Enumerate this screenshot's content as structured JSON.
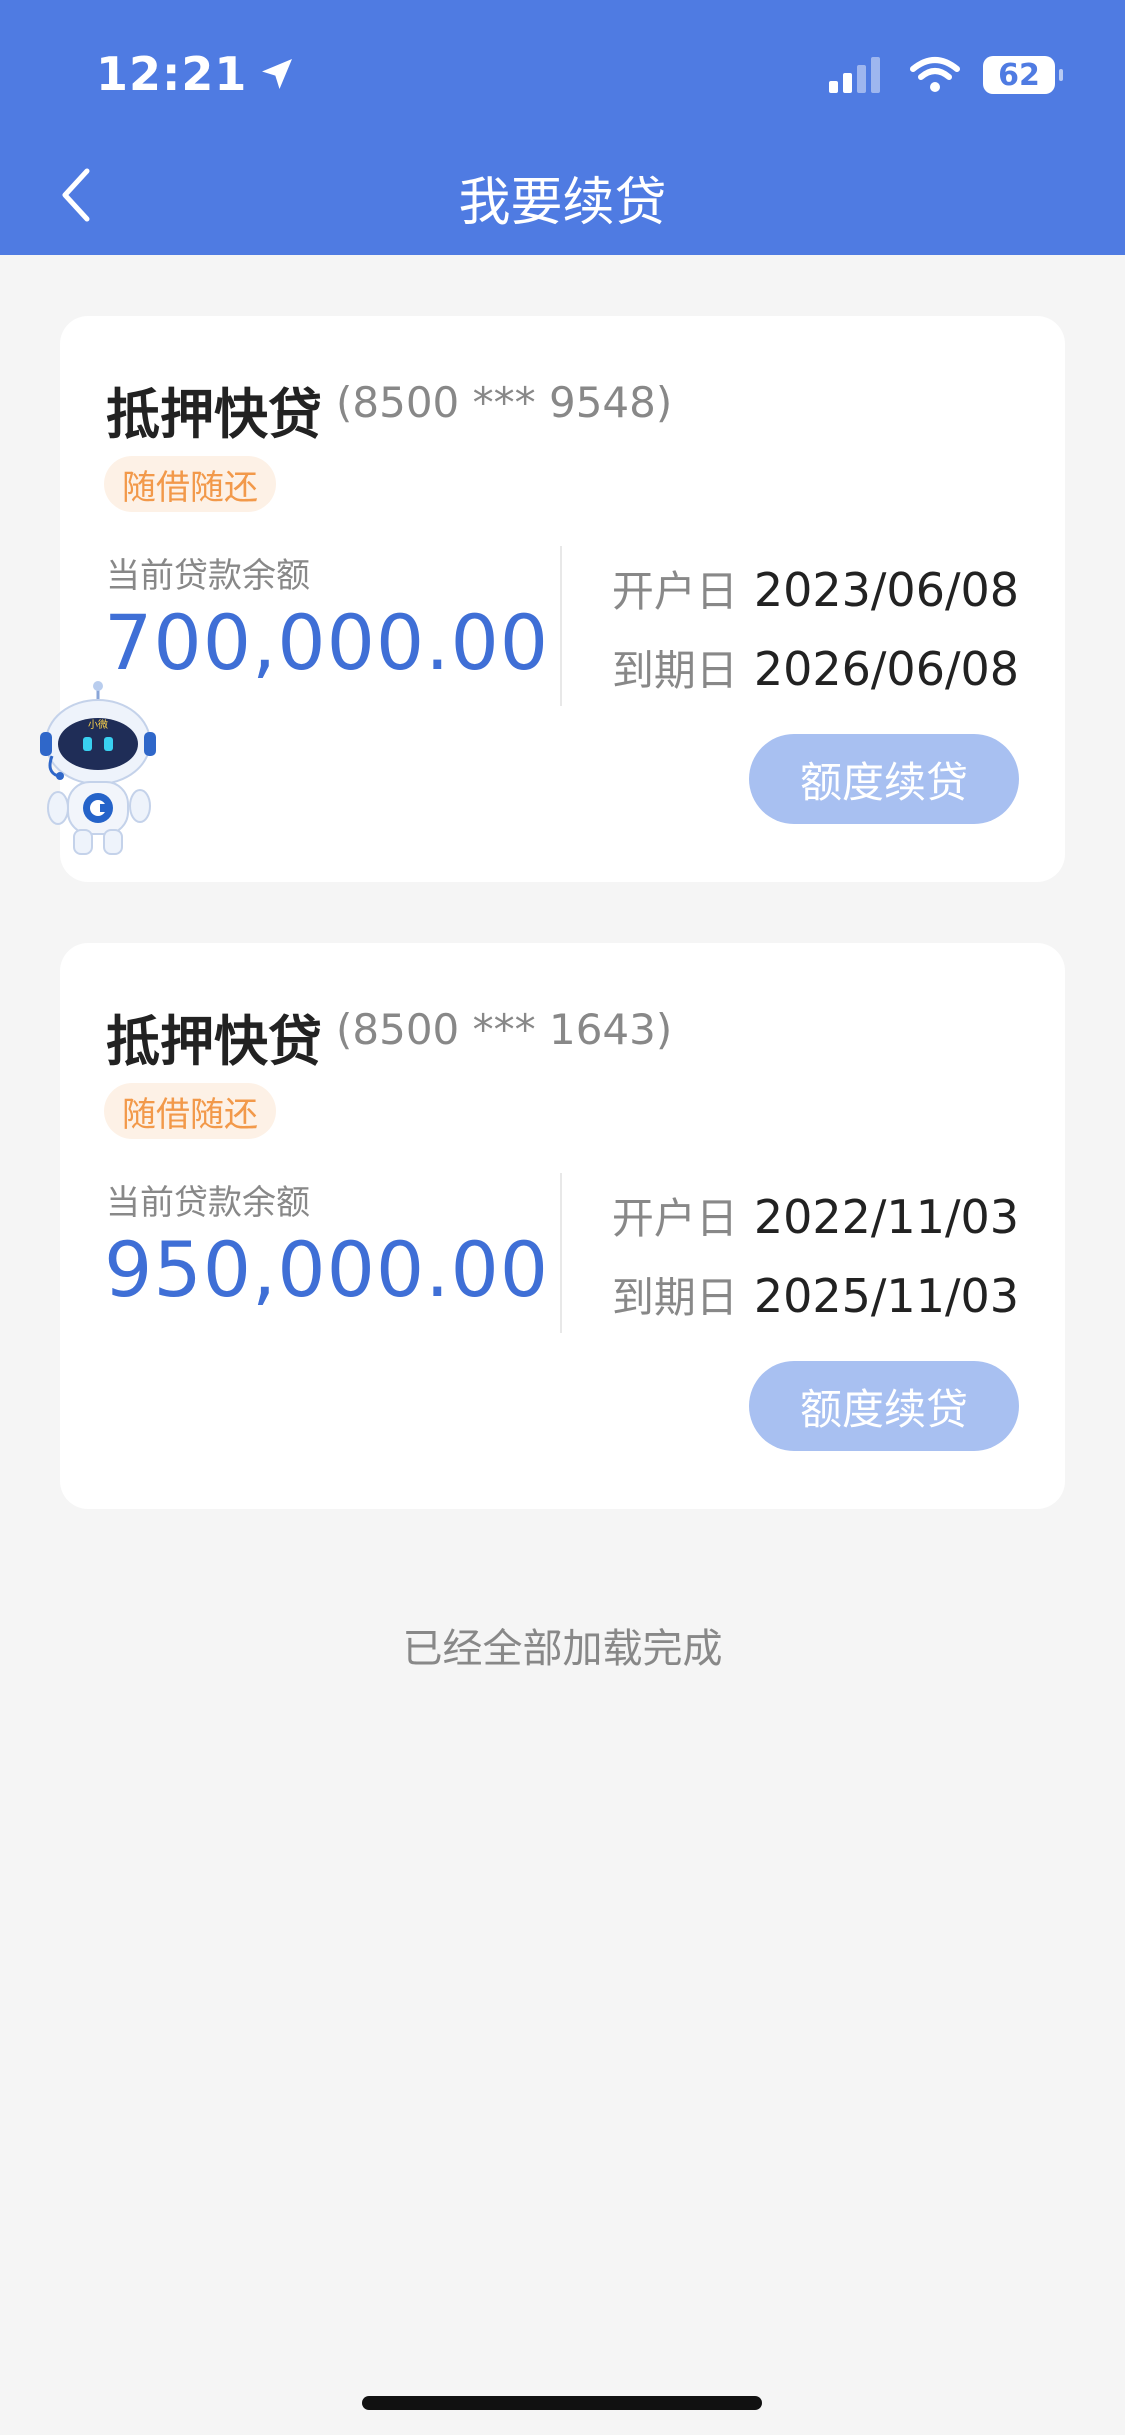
{
  "status_bar": {
    "time": "12:21",
    "battery": "62"
  },
  "header": {
    "title": "我要续贷"
  },
  "loans": [
    {
      "title": "抵押快贷",
      "account": "(8500 *** 9548)",
      "tag": "随借随还",
      "balance_label": "当前贷款余额",
      "balance": "700,000.00",
      "open_label": "开户日",
      "open_date": "2023/06/08",
      "due_label": "到期日",
      "due_date": "2026/06/08",
      "button": "额度续贷"
    },
    {
      "title": "抵押快贷",
      "account": "(8500 *** 1643)",
      "tag": "随借随还",
      "balance_label": "当前贷款余额",
      "balance": "950,000.00",
      "open_label": "开户日",
      "open_date": "2022/11/03",
      "due_label": "到期日",
      "due_date": "2025/11/03",
      "button": "额度续贷"
    }
  ],
  "footer": {
    "note": "已经全部加载完成"
  },
  "colors": {
    "header": "#4f7be2",
    "amount": "#3f6fd6",
    "tag_text": "#f2994a",
    "button": "#a8c0f1"
  },
  "mascot": {
    "badge": "小微"
  }
}
